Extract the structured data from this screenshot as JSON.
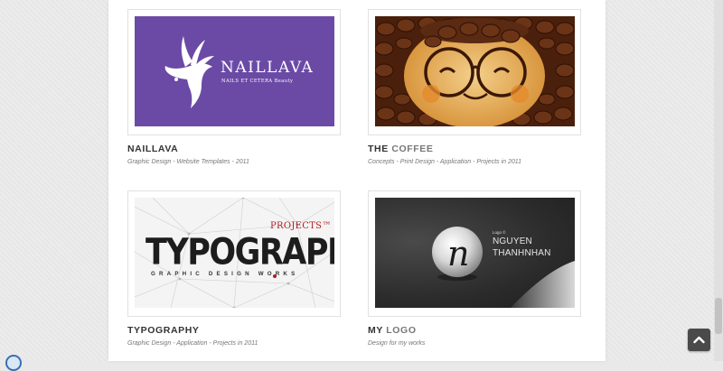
{
  "portfolio": {
    "items": [
      {
        "title": "NAILLAVA",
        "title_accent": "",
        "meta": "Graphic Design  - Website Templates - 2011",
        "thumb": {
          "logo_text": "NAILLAVA",
          "logo_sub": "NAILS ET CETERA Beauty",
          "bg": "#6b4aa6"
        }
      },
      {
        "title": "THE ",
        "title_accent": "COFFEE",
        "meta": "Concepts - Print Design  - Application  - Projects in 2011",
        "thumb": {
          "bg": "#5a2a12"
        }
      },
      {
        "title": "TYPOGRAPHY",
        "title_accent": "",
        "meta": "Graphic Design - Application  - Projects in 2011",
        "thumb": {
          "big": "TYPOGRAPHY",
          "projects": "PROJECTS™",
          "sub": "GRAPHIC DESIGN WORKS"
        }
      },
      {
        "title": "MY  ",
        "title_accent": "LOGO",
        "meta": "Design for my works",
        "thumb": {
          "small": "Logo ©",
          "name1": "NGUYEN",
          "name2": "THANHNHAN",
          "letter": "n"
        }
      }
    ]
  },
  "icons": {
    "scroll_top": "chevron-up-icon",
    "corner": "circle-icon"
  },
  "colors": {
    "purple": "#6b4aa6",
    "coffee": "#5a2a12",
    "typo_red": "#b01c22",
    "dark_bg": "#2c2c2c"
  }
}
